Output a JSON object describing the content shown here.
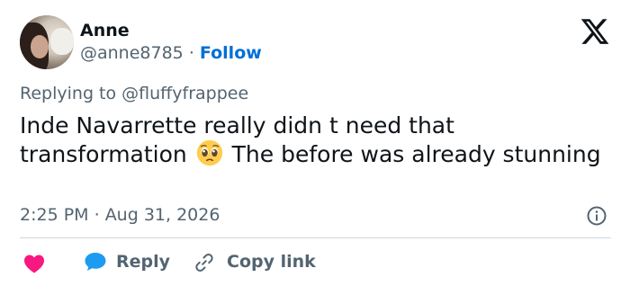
{
  "author": {
    "name": "Anne",
    "handle": "@anne8785",
    "separator": " · ",
    "follow_label": "Follow"
  },
  "reply_context": {
    "prefix": "Replying to ",
    "to_handle": "@fluffyfrappee"
  },
  "tweet": {
    "text_before_emoji": "Inde Navarrette really didn t need that transformation ",
    "emoji_name": "pleading-face-emoji",
    "text_after_emoji": " The before was already stunning"
  },
  "meta": {
    "time": "2:25 PM",
    "separator": " · ",
    "date": "Aug 31, 2026"
  },
  "actions": {
    "reply_label": "Reply",
    "copy_link_label": "Copy link"
  },
  "icons": {
    "brand": "x-logo-icon",
    "info": "info-icon",
    "like": "heart-icon",
    "reply": "reply-bubble-icon",
    "copy": "link-icon"
  },
  "colors": {
    "text": "#0f1419",
    "secondary": "#536471",
    "follow": "#006fd6",
    "heart": "#f91880",
    "reply_bubble": "#1d9bf0",
    "divider": "#cfd9de"
  }
}
